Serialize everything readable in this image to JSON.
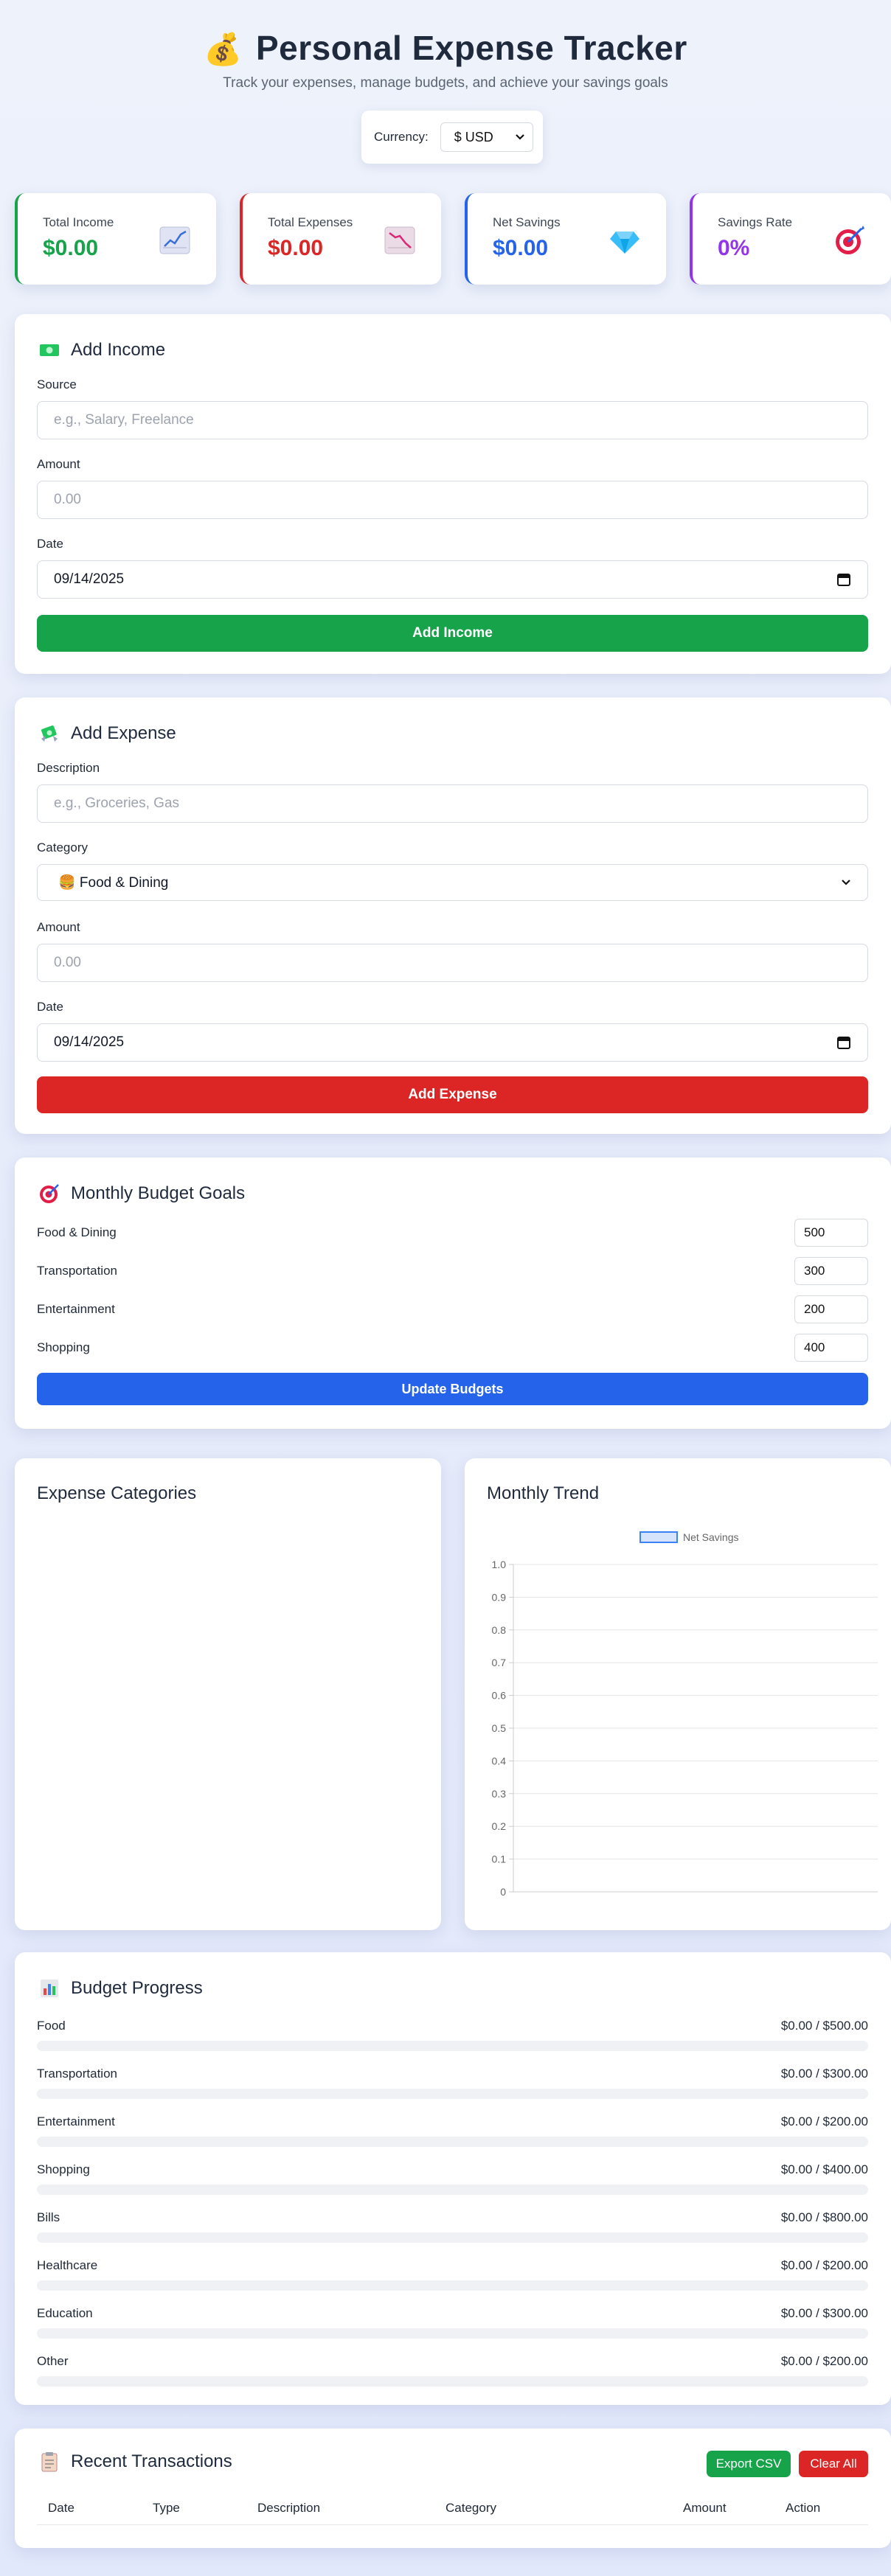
{
  "header": {
    "title": "Personal Expense Tracker",
    "subtitle": "Track your expenses, manage budgets, and achieve your savings goals"
  },
  "currency": {
    "label": "Currency:",
    "selected": "$ USD"
  },
  "stats": {
    "income": {
      "label": "Total Income",
      "value": "$0.00",
      "color": "#16a34a",
      "icon": "chart-up-icon"
    },
    "expenses": {
      "label": "Total Expenses",
      "value": "$0.00",
      "color": "#dc2626",
      "icon": "chart-down-icon"
    },
    "savings": {
      "label": "Net Savings",
      "value": "$0.00",
      "color": "#2563eb",
      "icon": "gem-icon"
    },
    "rate": {
      "label": "Savings Rate",
      "value": "0%",
      "color": "#9333ea",
      "icon": "target-icon"
    }
  },
  "income_form": {
    "title": "Add Income",
    "source_label": "Source",
    "source_placeholder": "e.g., Salary, Freelance",
    "amount_label": "Amount",
    "amount_placeholder": "0.00",
    "date_label": "Date",
    "date_value": "09/14/2025",
    "button": "Add Income"
  },
  "expense_form": {
    "title": "Add Expense",
    "description_label": "Description",
    "description_placeholder": "e.g., Groceries, Gas",
    "category_label": "Category",
    "category_value": "🍔 Food & Dining",
    "amount_label": "Amount",
    "amount_placeholder": "0.00",
    "date_label": "Date",
    "date_value": "09/14/2025",
    "button": "Add Expense"
  },
  "budget_goals": {
    "title": "Monthly Budget Goals",
    "items": [
      {
        "name": "Food & Dining",
        "value": "500"
      },
      {
        "name": "Transportation",
        "value": "300"
      },
      {
        "name": "Entertainment",
        "value": "200"
      },
      {
        "name": "Shopping",
        "value": "400"
      }
    ],
    "button": "Update Budgets"
  },
  "expense_categories": {
    "title": "Expense Categories"
  },
  "monthly_trend": {
    "title": "Monthly Trend"
  },
  "chart_data": {
    "type": "line",
    "title": "",
    "series": [
      {
        "name": "Net Savings",
        "values": []
      }
    ],
    "x": [],
    "ylim": [
      0,
      1.0
    ],
    "yticks": [
      "0",
      "0.1",
      "0.2",
      "0.3",
      "0.4",
      "0.5",
      "0.6",
      "0.7",
      "0.8",
      "0.9",
      "1.0"
    ],
    "grid": true,
    "legend": "top-center"
  },
  "budget_progress": {
    "title": "Budget Progress",
    "items": [
      {
        "name": "Food",
        "amount": "$0.00 / $500.00",
        "fraction": 0
      },
      {
        "name": "Transportation",
        "amount": "$0.00 / $300.00",
        "fraction": 0
      },
      {
        "name": "Entertainment",
        "amount": "$0.00 / $200.00",
        "fraction": 0
      },
      {
        "name": "Shopping",
        "amount": "$0.00 / $400.00",
        "fraction": 0
      },
      {
        "name": "Bills",
        "amount": "$0.00 / $800.00",
        "fraction": 0
      },
      {
        "name": "Healthcare",
        "amount": "$0.00 / $200.00",
        "fraction": 0
      },
      {
        "name": "Education",
        "amount": "$0.00 / $300.00",
        "fraction": 0
      },
      {
        "name": "Other",
        "amount": "$0.00 / $200.00",
        "fraction": 0
      }
    ]
  },
  "transactions": {
    "title": "Recent Transactions",
    "export_button": "Export CSV",
    "clear_button": "Clear All",
    "columns": [
      "Date",
      "Type",
      "Description",
      "Category",
      "Amount",
      "Action"
    ]
  },
  "colors": {
    "income_button": "#16a34a",
    "expense_button": "#dc2626",
    "budget_button": "#2563eb"
  }
}
